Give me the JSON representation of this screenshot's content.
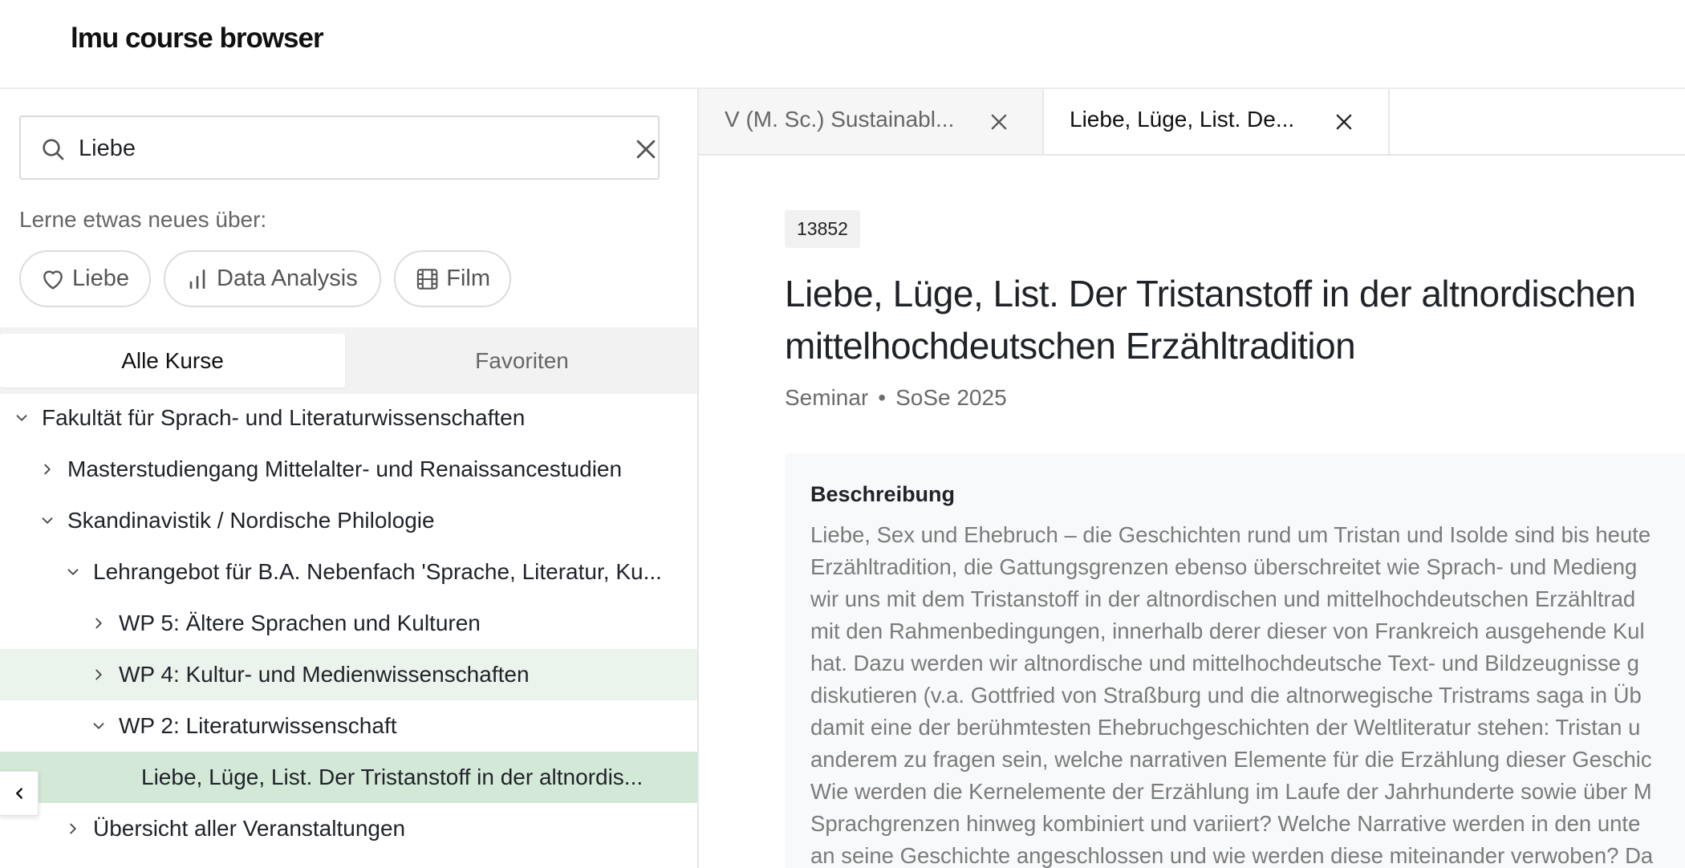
{
  "app": {
    "title": "lmu course browser"
  },
  "search": {
    "value": "Liebe",
    "placeholder": ""
  },
  "suggestions": {
    "label": "Lerne etwas neues über:",
    "chips": [
      {
        "label": "Liebe",
        "icon": "heart-icon"
      },
      {
        "label": "Data Analysis",
        "icon": "bar-chart-icon"
      },
      {
        "label": "Film",
        "icon": "film-icon"
      }
    ]
  },
  "segmented": {
    "all": "Alle Kurse",
    "favorites": "Favoriten"
  },
  "tree": [
    {
      "label": "Fakultät für Sprach- und Literaturwissenschaften",
      "expanded": true
    },
    {
      "label": "Masterstudiengang Mittelalter- und Renaissancestudien",
      "expanded": false
    },
    {
      "label": "Skandinavistik / Nordische Philologie",
      "expanded": true
    },
    {
      "label": "Lehrangebot für B.A. Nebenfach 'Sprache, Literatur, Ku...",
      "expanded": true
    },
    {
      "label": "WP 5: Ältere Sprachen und Kulturen",
      "expanded": false
    },
    {
      "label": "WP 4: Kultur- und Medienwissenschaften",
      "expanded": false
    },
    {
      "label": "WP 2: Literaturwissenschaft",
      "expanded": true
    },
    {
      "label": "Liebe, Lüge, List. Der Tristanstoff in der altnordis...",
      "expanded": null
    },
    {
      "label": "Übersicht aller Veranstaltungen",
      "expanded": false
    }
  ],
  "tabs": [
    {
      "label": "V (M. Sc.) Sustainabl...",
      "active": false
    },
    {
      "label": "Liebe, Lüge, List. De...",
      "active": true
    }
  ],
  "course": {
    "id": "13852",
    "title_line1": "Liebe, Lüge, List. Der Tristanstoff in der altnordischen",
    "title_line2": "mittelhochdeutschen Erzähltradition",
    "type": "Seminar",
    "separator": "•",
    "term": "SoSe 2025",
    "description_heading": "Beschreibung",
    "description_lines": [
      "Liebe, Sex und Ehebruch – die Geschichten rund um Tristan und Isolde sind bis heute",
      "Erzähltradition, die Gattungsgrenzen ebenso überschreitet wie Sprach- und Medieng",
      "wir uns mit dem Tristanstoff in der altnordischen und mittelhochdeutschen Erzähltrad",
      "mit den Rahmenbedingungen, innerhalb derer dieser von Frankreich ausgehende Kul",
      "hat. Dazu werden wir altnordische und mittelhochdeutsche Text- und Bildzeugnisse g",
      "diskutieren (v.a. Gottfried von Straßburg und die altnorwegische Tristrams saga in Üb",
      "damit eine der berühmtesten Ehebruchgeschichten der Weltliteratur stehen: Tristan u",
      "anderem zu fragen sein, welche narrativen Elemente für die Erzählung dieser Geschic",
      "Wie werden die Kernelemente der Erzählung im Laufe der Jahrhunderte sowie über M",
      "Sprachgrenzen hinweg kombiniert und variiert? Welche Narrative werden in den unte",
      "an seine Geschichte angeschlossen und wie werden diese miteinander verwoben? Da"
    ]
  },
  "colors": {
    "highlight_light": "#ebf3ed",
    "highlight_strong": "#d4e8d8",
    "border": "#e6e6e6",
    "muted_text": "#666666"
  }
}
